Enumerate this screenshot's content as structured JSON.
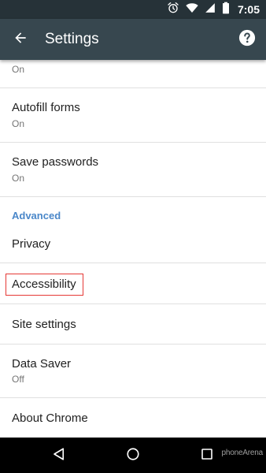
{
  "status_bar": {
    "time": "7:05",
    "icons": [
      "alarm-icon",
      "wifi-icon",
      "cellular-signal-icon",
      "battery-icon"
    ]
  },
  "toolbar": {
    "title": "Settings",
    "back_icon": "arrow-back-icon",
    "help_icon": "help-icon"
  },
  "settings": {
    "partial_item": {
      "status": "On"
    },
    "autofill": {
      "title": "Autofill forms",
      "status": "On"
    },
    "save_passwords": {
      "title": "Save passwords",
      "status": "On"
    },
    "advanced_header": "Advanced",
    "privacy": {
      "title": "Privacy"
    },
    "accessibility": {
      "title": "Accessibility"
    },
    "site_settings": {
      "title": "Site settings"
    },
    "data_saver": {
      "title": "Data Saver",
      "status": "Off"
    },
    "about_chrome": {
      "title": "About Chrome"
    }
  },
  "nav_bar": {
    "back_icon": "nav-back-icon",
    "home_icon": "nav-home-icon",
    "recents_icon": "nav-recents-icon"
  },
  "watermark": "phoneArena",
  "colors": {
    "status_bar": "#263238",
    "toolbar": "#37474f",
    "accent": "#4a87c9",
    "highlight": "#e53935",
    "nav_bar": "#000000"
  }
}
